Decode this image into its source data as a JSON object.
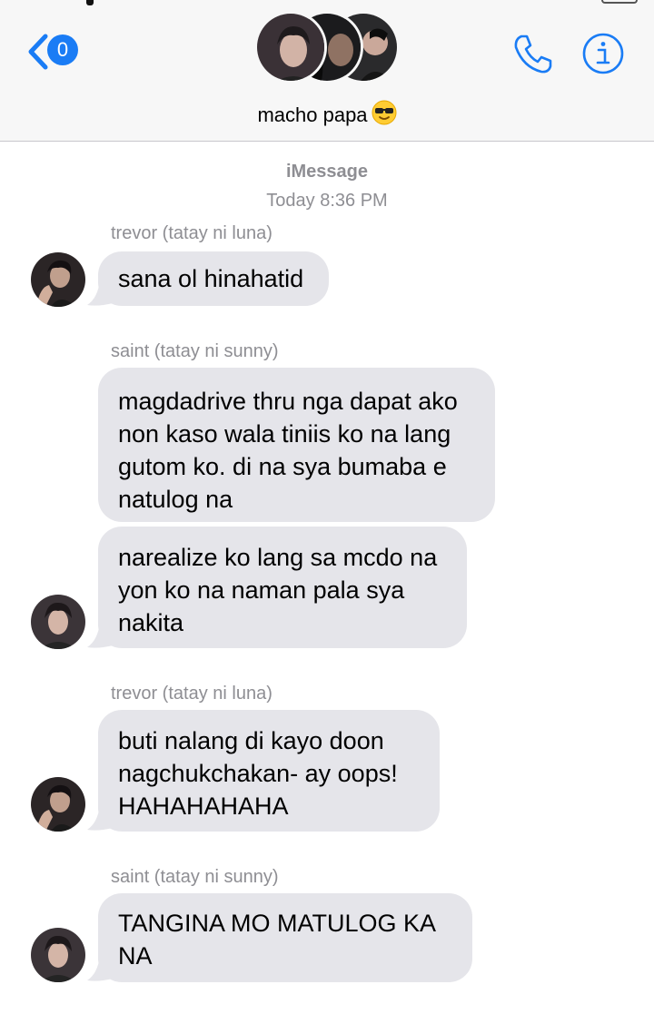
{
  "header": {
    "back_badge": "0",
    "group_name": "macho papa",
    "icons": {
      "back": "chevron-left-icon",
      "call": "phone-icon",
      "info": "info-icon",
      "emoji": "sunglasses-emoji-icon"
    },
    "accent_color": "#1a7cf5"
  },
  "thread": {
    "service": "iMessage",
    "timestamp": "Today 8:36 PM"
  },
  "messages": [
    {
      "sender": "trevor (tatay ni luna)",
      "text": "sana ol hinahatid"
    },
    {
      "sender": "saint (tatay ni sunny)",
      "text": "magdadrive thru nga dapat ako\nnon kaso wala tiniis ko na lang\ngutom ko. di na sya bumaba e\nnatulog na"
    },
    {
      "sender": "",
      "text": "narealize ko lang sa mcdo na\nyon ko na naman pala sya\nnakita"
    },
    {
      "sender": "trevor (tatay ni luna)",
      "text": "buti nalang di kayo doon\nnagchukchakan- ay oops!\nHAHAHAHAHA"
    },
    {
      "sender": "saint (tatay ni sunny)",
      "text": "TANGINA MO MATULOG KA\nNA"
    }
  ],
  "colors": {
    "bubble": "#e5e5ea",
    "meta_text": "#8e8e93"
  }
}
